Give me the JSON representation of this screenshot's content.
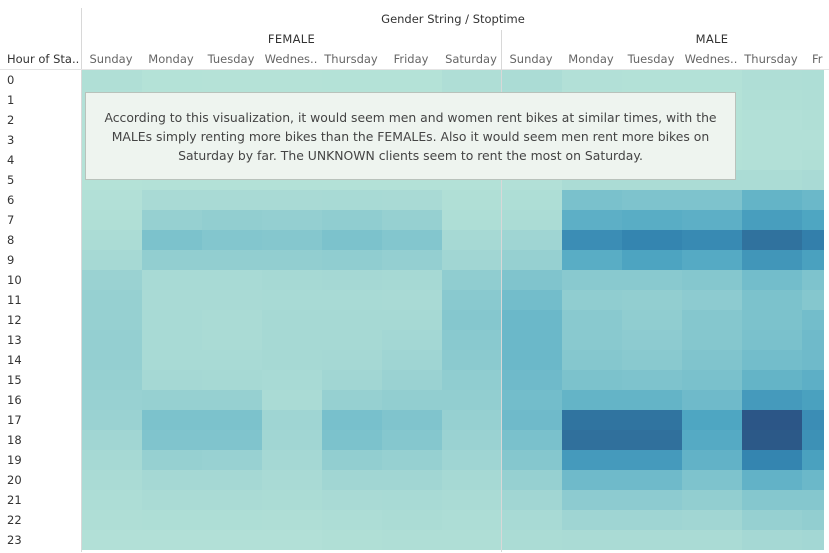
{
  "title": "Gender String / Stoptime",
  "row_header": "Hour of Sta..",
  "annotation": "According to this visualization, it would seem men and women rent bikes at similar times, with the MALEs simply renting more bikes than the FEMALEs. Also it would seem men rent more bikes on Saturday by far. The UNKNOWN clients seem to rent the most on Saturday.",
  "groups": [
    {
      "name": "FEMALE",
      "day_labels": [
        "Sunday",
        "Monday",
        "Tuesday",
        "Wednes..",
        "Thursday",
        "Friday",
        "Saturday"
      ]
    },
    {
      "name": "MALE",
      "day_labels": [
        "Sunday",
        "Monday",
        "Tuesday",
        "Wednes..",
        "Thursday",
        "Fr"
      ]
    }
  ],
  "chart_data": {
    "type": "heatmap",
    "title": "Gender String / Stoptime",
    "row_label": "Hour of Sta..",
    "rows": [
      "0",
      "1",
      "2",
      "3",
      "4",
      "5",
      "6",
      "7",
      "8",
      "9",
      "10",
      "11",
      "12",
      "13",
      "14",
      "15",
      "16",
      "17",
      "18",
      "19",
      "20",
      "21",
      "22",
      "23"
    ],
    "columns": [
      {
        "group": "FEMALE",
        "day": "Sunday"
      },
      {
        "group": "FEMALE",
        "day": "Monday"
      },
      {
        "group": "FEMALE",
        "day": "Tuesday"
      },
      {
        "group": "FEMALE",
        "day": "Wednes.."
      },
      {
        "group": "FEMALE",
        "day": "Thursday"
      },
      {
        "group": "FEMALE",
        "day": "Friday"
      },
      {
        "group": "FEMALE",
        "day": "Saturday"
      },
      {
        "group": "MALE",
        "day": "Sunday"
      },
      {
        "group": "MALE",
        "day": "Monday"
      },
      {
        "group": "MALE",
        "day": "Tuesday"
      },
      {
        "group": "MALE",
        "day": "Wednes.."
      },
      {
        "group": "MALE",
        "day": "Thursday"
      },
      {
        "group": "MALE",
        "day": "Fr"
      }
    ],
    "value_scale": "relative intensity 0-1 (no printed legend)",
    "color_range": [
      "#b6e4d6",
      "#2b5283"
    ],
    "values": [
      [
        0.06,
        0.03,
        0.02,
        0.02,
        0.03,
        0.03,
        0.07,
        0.1,
        0.05,
        0.04,
        0.04,
        0.07,
        0.08
      ],
      [
        0.05,
        0.02,
        0.02,
        0.02,
        0.02,
        0.02,
        0.06,
        0.09,
        0.04,
        0.03,
        0.03,
        0.06,
        0.07
      ],
      [
        0.04,
        0.02,
        0.02,
        0.02,
        0.02,
        0.02,
        0.05,
        0.08,
        0.03,
        0.03,
        0.03,
        0.05,
        0.06
      ],
      [
        0.03,
        0.02,
        0.02,
        0.02,
        0.02,
        0.02,
        0.04,
        0.06,
        0.03,
        0.03,
        0.03,
        0.05,
        0.05
      ],
      [
        0.03,
        0.02,
        0.02,
        0.02,
        0.02,
        0.02,
        0.03,
        0.05,
        0.04,
        0.04,
        0.04,
        0.05,
        0.06
      ],
      [
        0.03,
        0.04,
        0.04,
        0.04,
        0.04,
        0.04,
        0.04,
        0.05,
        0.1,
        0.1,
        0.1,
        0.1,
        0.12
      ],
      [
        0.05,
        0.12,
        0.12,
        0.12,
        0.13,
        0.12,
        0.06,
        0.08,
        0.35,
        0.33,
        0.33,
        0.45,
        0.42
      ],
      [
        0.06,
        0.22,
        0.24,
        0.23,
        0.25,
        0.22,
        0.08,
        0.1,
        0.48,
        0.5,
        0.48,
        0.6,
        0.55
      ],
      [
        0.1,
        0.34,
        0.31,
        0.3,
        0.34,
        0.31,
        0.14,
        0.18,
        0.7,
        0.75,
        0.72,
        0.85,
        0.78
      ],
      [
        0.14,
        0.24,
        0.24,
        0.24,
        0.25,
        0.23,
        0.17,
        0.22,
        0.5,
        0.56,
        0.52,
        0.65,
        0.58
      ],
      [
        0.2,
        0.13,
        0.13,
        0.14,
        0.15,
        0.14,
        0.25,
        0.32,
        0.28,
        0.28,
        0.3,
        0.38,
        0.33
      ],
      [
        0.22,
        0.12,
        0.12,
        0.13,
        0.13,
        0.12,
        0.28,
        0.38,
        0.25,
        0.24,
        0.26,
        0.34,
        0.3
      ],
      [
        0.22,
        0.13,
        0.11,
        0.14,
        0.14,
        0.14,
        0.3,
        0.42,
        0.28,
        0.25,
        0.3,
        0.34,
        0.38
      ],
      [
        0.23,
        0.13,
        0.11,
        0.14,
        0.14,
        0.16,
        0.28,
        0.42,
        0.28,
        0.26,
        0.3,
        0.35,
        0.4
      ],
      [
        0.23,
        0.13,
        0.13,
        0.14,
        0.15,
        0.18,
        0.27,
        0.42,
        0.3,
        0.28,
        0.32,
        0.38,
        0.4
      ],
      [
        0.22,
        0.15,
        0.14,
        0.13,
        0.17,
        0.2,
        0.25,
        0.4,
        0.34,
        0.33,
        0.35,
        0.45,
        0.48
      ],
      [
        0.21,
        0.22,
        0.22,
        0.11,
        0.22,
        0.24,
        0.24,
        0.38,
        0.45,
        0.45,
        0.4,
        0.62,
        0.58
      ],
      [
        0.2,
        0.34,
        0.34,
        0.18,
        0.36,
        0.32,
        0.22,
        0.4,
        0.84,
        0.84,
        0.55,
        0.98,
        0.7
      ],
      [
        0.17,
        0.32,
        0.32,
        0.17,
        0.34,
        0.3,
        0.2,
        0.35,
        0.86,
        0.86,
        0.52,
        0.97,
        0.68
      ],
      [
        0.14,
        0.22,
        0.21,
        0.15,
        0.24,
        0.22,
        0.18,
        0.3,
        0.62,
        0.62,
        0.46,
        0.75,
        0.58
      ],
      [
        0.11,
        0.15,
        0.15,
        0.12,
        0.17,
        0.17,
        0.14,
        0.22,
        0.4,
        0.4,
        0.33,
        0.46,
        0.42
      ],
      [
        0.09,
        0.11,
        0.11,
        0.1,
        0.12,
        0.13,
        0.11,
        0.17,
        0.26,
        0.26,
        0.24,
        0.3,
        0.3
      ],
      [
        0.07,
        0.08,
        0.08,
        0.07,
        0.09,
        0.1,
        0.09,
        0.13,
        0.18,
        0.18,
        0.17,
        0.22,
        0.24
      ],
      [
        0.05,
        0.05,
        0.05,
        0.05,
        0.06,
        0.07,
        0.07,
        0.1,
        0.11,
        0.11,
        0.11,
        0.15,
        0.16
      ]
    ]
  }
}
